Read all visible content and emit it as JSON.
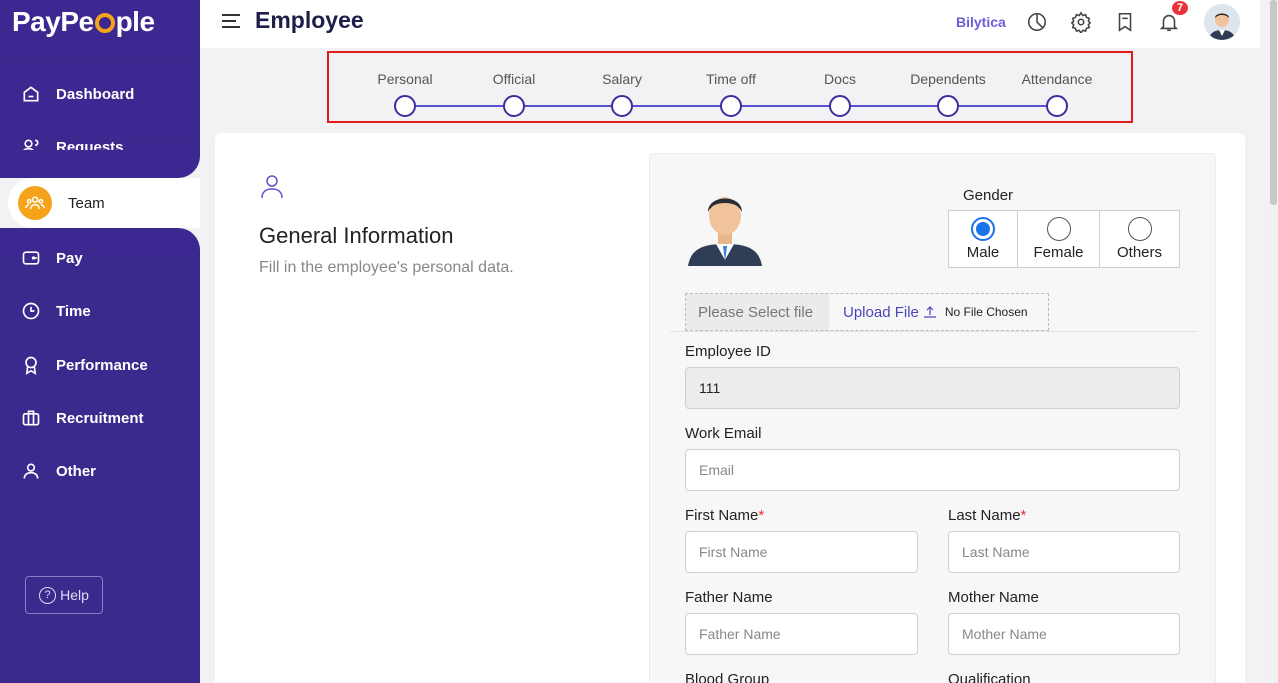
{
  "app": {
    "logo": {
      "pre": "PayPe",
      "post": "ple"
    },
    "page_title": "Employee",
    "company": "Bilytica",
    "notification_count": "7"
  },
  "sidebar": {
    "items": [
      {
        "label": "Dashboard",
        "icon": "home-icon"
      },
      {
        "label": "Requests",
        "icon": "requests-icon"
      },
      {
        "label": "Team",
        "icon": "team-icon",
        "active": true
      },
      {
        "label": "Pay",
        "icon": "wallet-icon"
      },
      {
        "label": "Time",
        "icon": "clock-icon"
      },
      {
        "label": "Performance",
        "icon": "award-icon"
      },
      {
        "label": "Recruitment",
        "icon": "briefcase-icon"
      },
      {
        "label": "Other",
        "icon": "user-icon"
      }
    ],
    "help_label": "Help",
    "help_glyph": "?"
  },
  "stepper": {
    "steps": [
      "Personal",
      "Official",
      "Salary",
      "Time off",
      "Docs",
      "Dependents",
      "Attendance"
    ]
  },
  "section": {
    "title": "General Information",
    "subtitle": "Fill in the employee's personal data."
  },
  "form": {
    "gender_label": "Gender",
    "gender_options": [
      "Male",
      "Female",
      "Others"
    ],
    "gender_selected": "Male",
    "upload_placeholder": "Please Select file",
    "upload_link": "Upload File",
    "upload_status": "No File Chosen",
    "employee_id_label": "Employee ID",
    "employee_id_value": "111",
    "work_email_label": "Work Email",
    "work_email_placeholder": "Email",
    "first_name_label": "First Name",
    "first_name_placeholder": "First Name",
    "last_name_label": "Last Name",
    "last_name_placeholder": "Last Name",
    "father_name_label": "Father Name",
    "father_name_placeholder": "Father Name",
    "mother_name_label": "Mother Name",
    "mother_name_placeholder": "Mother Name",
    "blood_group_label": "Blood Group",
    "qualification_label": "Qualification",
    "required_mark": "*"
  },
  "colors": {
    "sidebar": "#3d2790",
    "accent": "#5a4fcf",
    "team_badge": "#f5a31a",
    "highlight_border": "#e01b1b",
    "radio_selected": "#1a73e8",
    "notification": "#e8333a"
  }
}
